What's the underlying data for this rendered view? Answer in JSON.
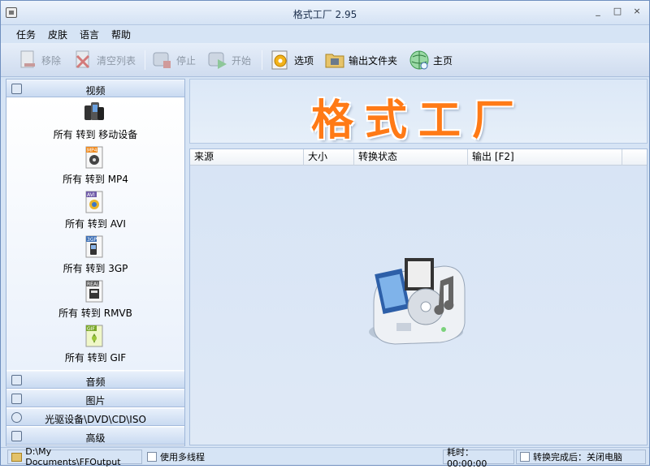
{
  "window": {
    "title": "格式工厂 2.95",
    "controls": [
      "_",
      "□",
      "×"
    ]
  },
  "menu": [
    "任务",
    "皮肤",
    "语言",
    "帮助"
  ],
  "toolbar": {
    "remove": "移除",
    "clear": "清空列表",
    "stop": "停止",
    "start": "开始",
    "options": "选项",
    "output_folder": "输出文件夹",
    "home": "主页"
  },
  "sidebar": {
    "video_header": "视频",
    "video_items": [
      {
        "label": "所有 转到 移动设备",
        "icon": "mobile-devices-icon"
      },
      {
        "label": "所有 转到 MP4",
        "icon": "mp4-icon",
        "badge": "MP4"
      },
      {
        "label": "所有 转到 AVI",
        "icon": "avi-icon",
        "badge": "AVI"
      },
      {
        "label": "所有 转到 3GP",
        "icon": "3gp-icon",
        "badge": "3GP"
      },
      {
        "label": "所有 转到 RMVB",
        "icon": "rmvb-icon",
        "badge": "REAL"
      },
      {
        "label": "所有 转到 GIF",
        "icon": "gif-icon",
        "badge": "GIF"
      }
    ],
    "audio_header": "音频",
    "image_header": "图片",
    "disc_header": "光驱设备\\DVD\\CD\\ISO",
    "advanced_header": "高级"
  },
  "banner": {
    "logo": "格式工厂"
  },
  "table": {
    "columns": [
      "来源",
      "大小",
      "转换状态",
      "输出 [F2]"
    ]
  },
  "statusbar": {
    "output_path": "D:\\My Documents\\FFOutput",
    "multithread": "使用多线程",
    "elapsed": "耗时：00:00:00",
    "after_done": "转换完成后：关闭电脑"
  },
  "colors": {
    "logo": "#ff7a16",
    "panel": "#d6e4f5"
  }
}
